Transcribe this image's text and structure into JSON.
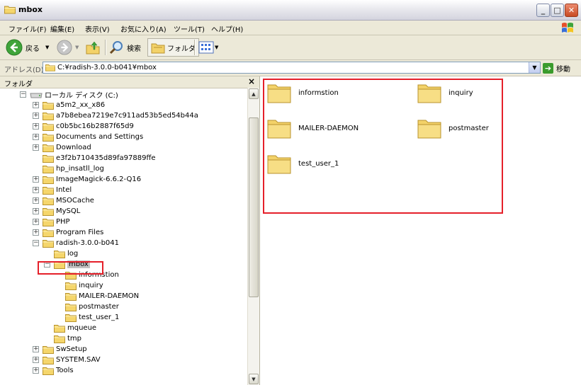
{
  "window": {
    "title": "mbox"
  },
  "menu": [
    "ファイル(F)",
    "編集(E)",
    "表示(V)",
    "お気に入り(A)",
    "ツール(T)",
    "ヘルプ(H)"
  ],
  "toolbar": {
    "back_label": "戻る",
    "search_label": "検索",
    "folders_label": "フォルダ"
  },
  "address": {
    "label": "アドレス(D)",
    "value": "C:¥radish-3.0.0-b041¥mbox",
    "go_label": "移動"
  },
  "folder_pane": {
    "title": "フォルダ",
    "close": "×"
  },
  "tree": {
    "root": "ローカル ディスク (C:)",
    "items": [
      "a5m2_xx_x86",
      "a7b8ebea7219e7c911ad53b5ed54b44a",
      "c0b5bc16b2887f65d9",
      "Documents and Settings",
      "Download",
      "e3f2b710435d89fa97889ffe",
      "hp_insatll_log",
      "ImageMagick-6.6.2-Q16",
      "Intel",
      "MSOCache",
      "MySQL",
      "PHP",
      "Program Files",
      "radish-3.0.0-b041",
      "log",
      "mbox",
      "informstion",
      "inquiry",
      "MAILER-DAEMON",
      "postmaster",
      "test_user_1",
      "mqueue",
      "tmp",
      "SwSetup",
      "SYSTEM.SAV",
      "Tools"
    ]
  },
  "content": {
    "folders": [
      "informstion",
      "inquiry",
      "MAILER-DAEMON",
      "postmaster",
      "test_user_1"
    ]
  },
  "colors": {
    "highlight": "#e5202a",
    "folder": "#f3d269"
  }
}
